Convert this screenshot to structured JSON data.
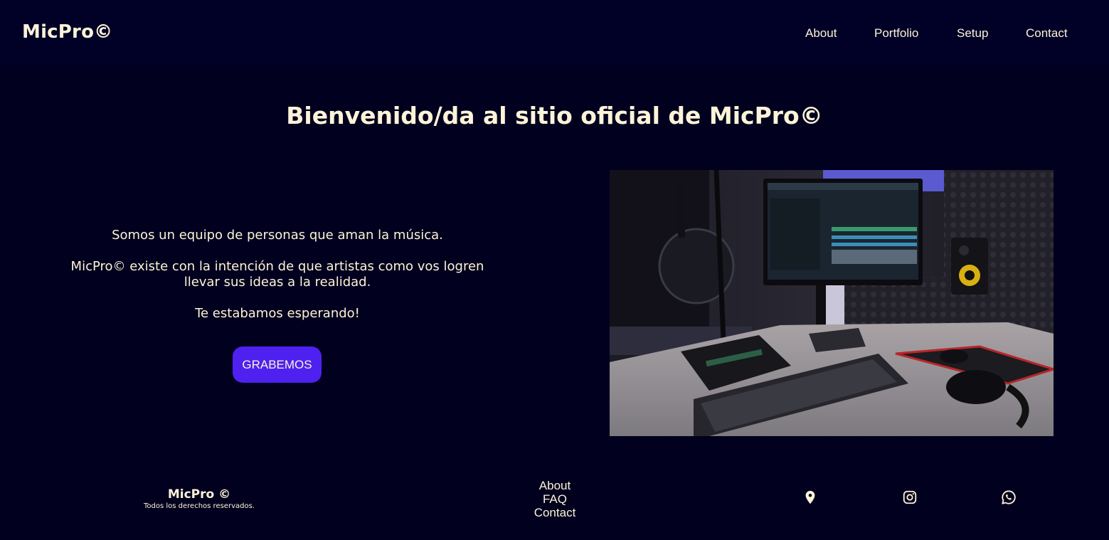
{
  "header": {
    "brand": "MicPro©",
    "nav": [
      {
        "label": "About"
      },
      {
        "label": "Portfolio"
      },
      {
        "label": "Setup"
      },
      {
        "label": "Contact"
      }
    ]
  },
  "main": {
    "title": "Bienvenido/da al sitio oficial de MicPro©",
    "paragraphs": [
      "Somos un equipo de personas que aman la música.",
      "MicPro© existe con la intención de que artistas como vos logren llevar sus ideas a la realidad.",
      "Te estabamos esperando!"
    ],
    "cta_label": "GRABEMOS",
    "photo_icon": "studio-desk-photo"
  },
  "footer": {
    "brand": "MicPro ©",
    "rights": "Todos los derechos reservados.",
    "links": [
      {
        "label": "About"
      },
      {
        "label": "FAQ"
      },
      {
        "label": "Contact"
      }
    ],
    "social": [
      {
        "icon": "location-pin-icon"
      },
      {
        "icon": "instagram-icon"
      },
      {
        "icon": "whatsapp-icon"
      }
    ]
  },
  "colors": {
    "background": "#01001e",
    "header_bg": "#010027",
    "text": "#fdf3d8",
    "accent": "#4f21f1"
  }
}
